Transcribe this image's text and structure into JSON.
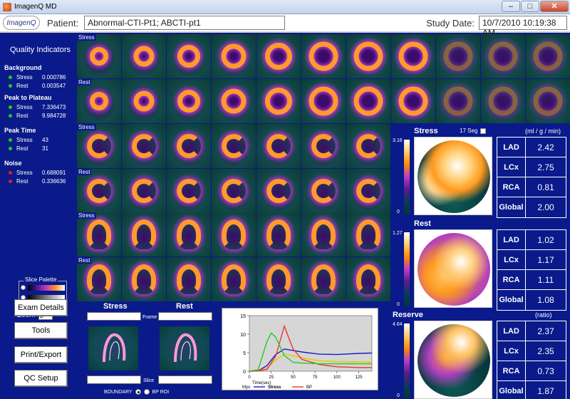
{
  "window": {
    "title": "ImagenQ MD"
  },
  "header": {
    "logo_text": "ImagenQ",
    "patient_label": "Patient:",
    "patient_value": "Abnormal-CTI-Pt1;    ABCTI-pt1",
    "study_date_label": "Study Date:",
    "study_date_value": "10/7/2010 10:19:38 AM"
  },
  "quality": {
    "title": "Quality Indicators",
    "groups": [
      {
        "name": "Background",
        "rows": [
          {
            "label": "Stress",
            "value": "0.000786",
            "color": "#22cc22"
          },
          {
            "label": "Rest",
            "value": "0.003547",
            "color": "#22cc22"
          }
        ]
      },
      {
        "name": "Peak to Plateau",
        "rows": [
          {
            "label": "Stress",
            "value": "7.336473",
            "color": "#22cc22"
          },
          {
            "label": "Rest",
            "value": "9.984728",
            "color": "#22cc22"
          }
        ]
      },
      {
        "name": "Peak Time",
        "rows": [
          {
            "label": "Stress",
            "value": "43",
            "color": "#22cc22"
          },
          {
            "label": "Rest",
            "value": "31",
            "color": "#22cc22"
          }
        ]
      },
      {
        "name": "Noise",
        "rows": [
          {
            "label": "Stress",
            "value": "0.688091",
            "color": "#dd2222"
          },
          {
            "label": "Rest",
            "value": "0.336636",
            "color": "#dd2222"
          }
        ]
      }
    ]
  },
  "palette": {
    "label": "Slice Palette"
  },
  "zoom": {
    "label": "Zoom",
    "value": "3"
  },
  "buttons": {
    "exam_details": "Exam Details",
    "tools": "Tools",
    "print_export": "Print/Export",
    "qc_setup": "QC Setup"
  },
  "rows": {
    "stress": "Stress",
    "rest": "Rest"
  },
  "maps": {
    "seg_label": "17 Seg",
    "stress": {
      "title": "Stress",
      "max": "3.16",
      "min": "0",
      "unit": "(ml / g / min)",
      "rows": [
        {
          "name": "LAD",
          "value": "2.42"
        },
        {
          "name": "LCx",
          "value": "2.75"
        },
        {
          "name": "RCA",
          "value": "0.81"
        },
        {
          "name": "Global",
          "value": "2.00"
        }
      ]
    },
    "rest": {
      "title": "Rest",
      "max": "1.27",
      "min": "0",
      "rows": [
        {
          "name": "LAD",
          "value": "1.02"
        },
        {
          "name": "LCx",
          "value": "1.17"
        },
        {
          "name": "RCA",
          "value": "1.11"
        },
        {
          "name": "Global",
          "value": "1.08"
        }
      ]
    },
    "reserve": {
      "title": "Reserve",
      "max": "4.64",
      "min": "0",
      "unit": "(ratio)",
      "rows": [
        {
          "name": "LAD",
          "value": "2.37"
        },
        {
          "name": "LCx",
          "value": "2.35"
        },
        {
          "name": "RCA",
          "value": "0.73"
        },
        {
          "name": "Global",
          "value": "1.87"
        }
      ]
    }
  },
  "bottom": {
    "stress_title": "Stress",
    "rest_title": "Rest",
    "frame_label": "Frame",
    "slice_label": "Slice",
    "boundary_label": "BOUNDARY",
    "bproi_label": "BP ROI"
  },
  "chart_data": {
    "type": "line",
    "xlabel": "Time(sec)",
    "xlim": [
      0,
      140
    ],
    "ylim": [
      0,
      15
    ],
    "xticks": [
      "0",
      "25",
      "50",
      "75",
      "100",
      "125"
    ],
    "yticks": [
      "0",
      "5",
      "10",
      "15"
    ],
    "legend": [
      {
        "group": "Myo",
        "stress": "Stress",
        "rest": "Rest"
      },
      {
        "group": "BP"
      }
    ],
    "series": [
      {
        "name": "Myo Stress",
        "color": "#1a1acc",
        "x": [
          0,
          10,
          20,
          30,
          40,
          50,
          60,
          80,
          100,
          125,
          140
        ],
        "y": [
          0,
          0.1,
          1.5,
          4.5,
          6.0,
          5.6,
          5.2,
          4.6,
          4.5,
          4.8,
          4.9
        ]
      },
      {
        "name": "Myo Rest",
        "color": "#e6c800",
        "x": [
          0,
          10,
          20,
          30,
          40,
          50,
          60,
          80,
          100,
          125,
          140
        ],
        "y": [
          0,
          0.1,
          0.8,
          3.0,
          4.6,
          4.2,
          3.6,
          2.8,
          2.6,
          2.5,
          2.5
        ]
      },
      {
        "name": "BP Stress",
        "color": "#ee3333",
        "x": [
          0,
          10,
          20,
          30,
          40,
          45,
          50,
          60,
          80,
          100,
          125,
          140
        ],
        "y": [
          0,
          0.1,
          0.5,
          4.0,
          12.2,
          9.0,
          6.0,
          3.2,
          1.8,
          1.2,
          1.0,
          1.0
        ]
      },
      {
        "name": "BP Rest",
        "color": "#22cc22",
        "x": [
          0,
          10,
          20,
          25,
          30,
          40,
          50,
          60,
          80,
          100,
          125,
          140
        ],
        "y": [
          0,
          0.4,
          8.0,
          10.3,
          9.2,
          4.2,
          2.4,
          2.2,
          2.0,
          2.0,
          2.0,
          2.0
        ]
      }
    ]
  }
}
